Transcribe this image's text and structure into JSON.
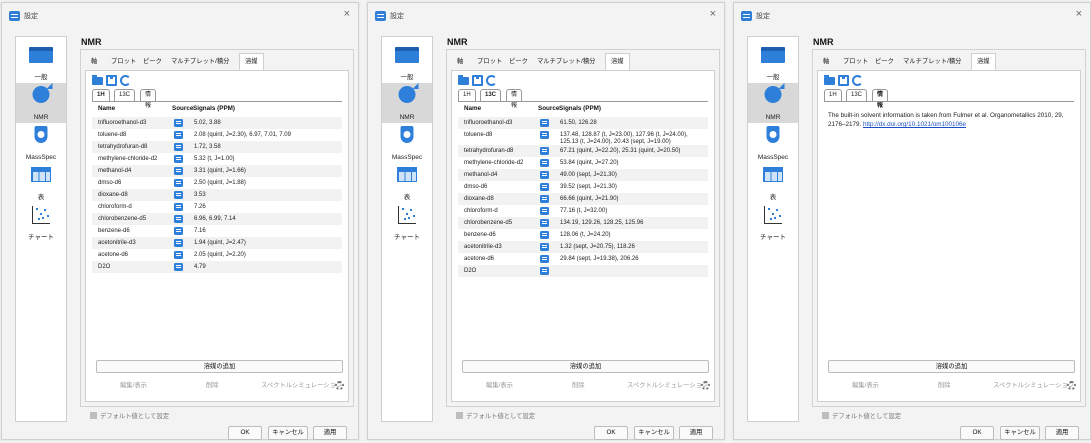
{
  "window_title": "設定",
  "sidebar": [
    {
      "label": "一般",
      "icon": "general-icon"
    },
    {
      "label": "NMR",
      "icon": "nmr-icon"
    },
    {
      "label": "MassSpec",
      "icon": "massspec-icon"
    },
    {
      "label": "表",
      "icon": "table-icon"
    },
    {
      "label": "チャート",
      "icon": "chart-icon"
    }
  ],
  "section_title": "NMR",
  "tabs": [
    "軸",
    "プロット",
    "ピーク",
    "マルチプレット/積分",
    "溶媒"
  ],
  "subtabs": [
    "1H",
    "13C",
    "情報"
  ],
  "columns": {
    "name": "Name",
    "source": "Source",
    "signals": "Signals (PPM)"
  },
  "solvents": [
    "trifluoroethanol-d3",
    "toluene-d8",
    "tetrahydrofuran-d8",
    "methylene-chloride-d2",
    "methanol-d4",
    "dmso-d6",
    "dioxane-d8",
    "chloroform-d",
    "chlorobenzene-d5",
    "benzene-d6",
    "acetonitrile-d3",
    "acetone-d6",
    "D2O"
  ],
  "signals_1h": [
    "5.02, 3.88",
    "2.08 (quint, J=2.30), 6.97, 7.01, 7.09",
    "1.72, 3.58",
    "5.32 (t, J=1.00)",
    "3.31 (quint, J=1.66)",
    "2.50 (quint, J=1.88)",
    "3.53",
    "7.26",
    "6.96, 6.99, 7.14",
    "7.16",
    "1.94 (quint, J=2.47)",
    "2.05 (quint, J=2.20)",
    "4.79"
  ],
  "signals_13c": [
    "61.50, 126.28",
    "137.48, 128.87 (t, J=23.00), 127.96 (t, J=24.00), 125.13 (t, J=24.00), 20.43 (sept, J=19.00)",
    "67.21 (quint, J=22.20), 25.31 (quint, J=20.50)",
    "53.84 (quint, J=27.20)",
    "49.00 (sept, J=21.30)",
    "39.52 (sept, J=21.30)",
    "66.66 (quint, J=21.90)",
    "77.16 (t, J=32.00)",
    "134.19, 129.26, 128.25, 125.96",
    "128.06 (t, J=24.20)",
    "1.32 (sept, J=20.75), 118.26",
    "29.84 (sept, J=19.38), 206.26",
    ""
  ],
  "info_text": "The built-in solvent information is taken from Fulmer et al. Organometallics 2010, 29, 2176–2179.",
  "info_link": "http://dx.doi.org/10.1021/om100106e",
  "buttons": {
    "add": "溶媒の追加",
    "edit": "編集/表示",
    "delete": "削除",
    "spectrum_sim": "スペクトルシミュレーション",
    "default_checkbox": "デフォルト値として設定",
    "ok": "OK",
    "cancel": "キャンセル",
    "apply": "適用"
  }
}
